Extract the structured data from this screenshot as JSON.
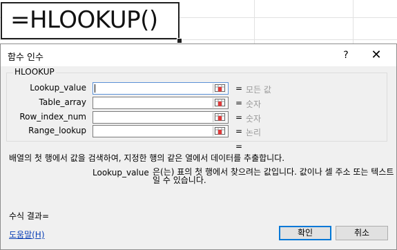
{
  "cell": {
    "formula": "=HLOOKUP()"
  },
  "dialog": {
    "title": "함수 인수",
    "help_button": "?",
    "close_button": "✕",
    "function_name": "HLOOKUP",
    "args": [
      {
        "label": "Lookup_value",
        "value": "",
        "hint": "모든 값"
      },
      {
        "label": "Table_array",
        "value": "",
        "hint": "숫자"
      },
      {
        "label": "Row_index_num",
        "value": "",
        "hint": "숫자"
      },
      {
        "label": "Range_lookup",
        "value": "",
        "hint": "논리"
      }
    ],
    "equals": "=",
    "description": "배열의 첫 행에서 값을 검색하여, 지정한 행의 같은 열에서 데이터를 추출합니다.",
    "current_arg_name": "Lookup_value",
    "current_arg_desc": "은(는) 표의 첫 행에서 찾으려는 값입니다. 값이나 셀 주소 또는 텍스트일 수 있습니다.",
    "result_label": "수식 결과=",
    "help_link": "도움말(H)",
    "ok_label": "확인",
    "cancel_label": "취소"
  }
}
